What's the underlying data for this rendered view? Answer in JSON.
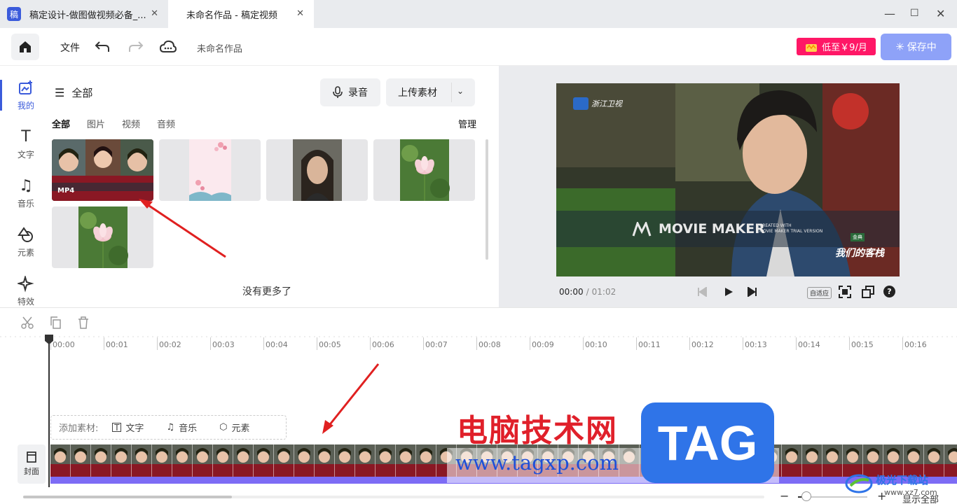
{
  "tabs": [
    {
      "label": "稿定设计-做图做视频必备_...",
      "app_icon": "稿"
    },
    {
      "label": "未命名作品 - 稿定视频"
    }
  ],
  "toolbar": {
    "file": "文件",
    "project_name": "未命名作品",
    "vip": "低至￥9/月",
    "save": "保存中"
  },
  "sidebar": [
    {
      "label": "我的",
      "icon": "my-upload-icon"
    },
    {
      "label": "文字",
      "icon": "text-icon"
    },
    {
      "label": "音乐",
      "icon": "music-icon"
    },
    {
      "label": "元素",
      "icon": "element-icon"
    },
    {
      "label": "特效",
      "icon": "effects-icon"
    }
  ],
  "media": {
    "category": "全部",
    "record": "录音",
    "upload": "上传素材",
    "filters": [
      "全部",
      "图片",
      "视频",
      "音频"
    ],
    "manage": "管理",
    "mp4_badge": "MP4",
    "no_more": "没有更多了"
  },
  "preview": {
    "current_time": "00:00",
    "separator": "/",
    "total_time": "01:02",
    "fit": "自适应",
    "watermark": "MOVIE MAKER",
    "watermark_sub1": "CREATED WITH",
    "watermark_sub2": "MOVIE MAKER TRIAL VERSION",
    "channel_logo": "浙江卫视",
    "show_logo": "我们的客栈",
    "show_badge": "金典"
  },
  "timeline": {
    "ticks": [
      "00:00",
      "00:01",
      "00:02",
      "00:03",
      "00:04",
      "00:05",
      "00:06",
      "00:07",
      "00:08",
      "00:09",
      "00:10",
      "00:11",
      "00:12",
      "00:13",
      "00:14",
      "00:15",
      "00:16"
    ],
    "add_label": "添加素材:",
    "add_text": "文字",
    "add_music": "音乐",
    "add_element": "元素",
    "cover": "封面",
    "show_all": "显示全部",
    "zoom_level": 0.12
  },
  "overlay": {
    "site_name": "电脑技术网",
    "site_url": "www.tagxp.com",
    "tag_logo": "TAG",
    "corner_text": "极光下载站",
    "corner_url": "www.xz7.com"
  },
  "colors": {
    "accent": "#3b5bdb",
    "vip": "#ff1766",
    "save": "#8ea2f8",
    "clip_bar": "#7d6cf5",
    "arrow": "#e02020"
  }
}
